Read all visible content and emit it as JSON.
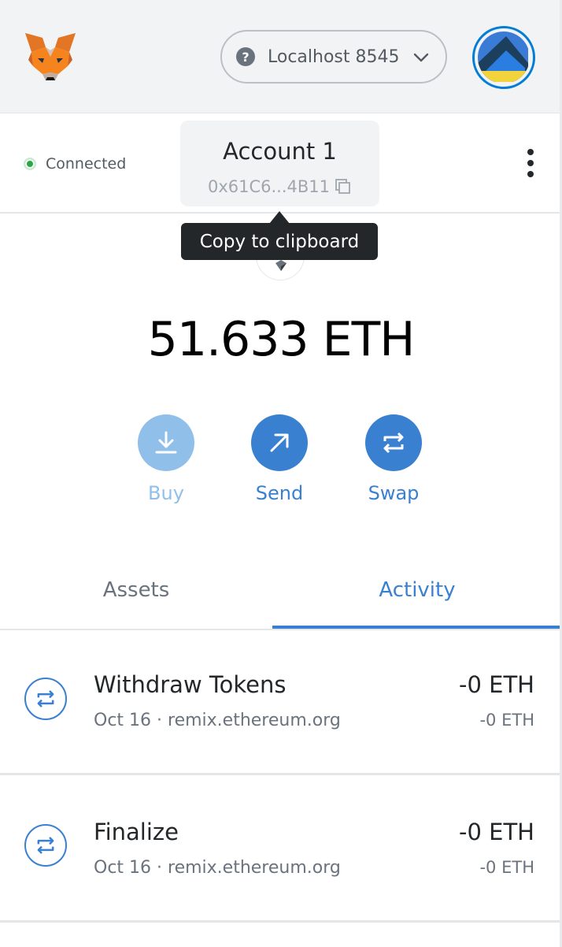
{
  "header": {
    "network": "Localhost 8545",
    "help_symbol": "?"
  },
  "account": {
    "status": "Connected",
    "name": "Account 1",
    "address": "0x61C6...4B11"
  },
  "tooltip": "Copy to clipboard",
  "balance": "51.633 ETH",
  "actions": {
    "buy": "Buy",
    "send": "Send",
    "swap": "Swap"
  },
  "tabs": {
    "assets": "Assets",
    "activity": "Activity",
    "selected": "Activity"
  },
  "transactions": [
    {
      "title": "Withdraw Tokens",
      "date": "Oct 16",
      "origin": "remix.ethereum.org",
      "subtitle": "Oct 16 · remix.ethereum.org",
      "amount": "-0 ETH",
      "amount_secondary": "-0 ETH"
    },
    {
      "title": "Finalize",
      "date": "Oct 16",
      "origin": "remix.ethereum.org",
      "subtitle": "Oct 16 · remix.ethereum.org",
      "amount": "-0 ETH",
      "amount_secondary": "-0 ETH"
    }
  ],
  "colors": {
    "accent": "#3a80d0",
    "accent_disabled": "#90bfea",
    "connected": "#28a745",
    "header_bg": "#f2f3f4"
  },
  "icons": [
    "metamask-fox-logo",
    "help-icon",
    "chevron-down-icon",
    "account-avatar",
    "copy-icon",
    "kebab-menu-icon",
    "eth-token-icon",
    "download-icon",
    "arrow-up-right-icon",
    "swap-icon"
  ]
}
